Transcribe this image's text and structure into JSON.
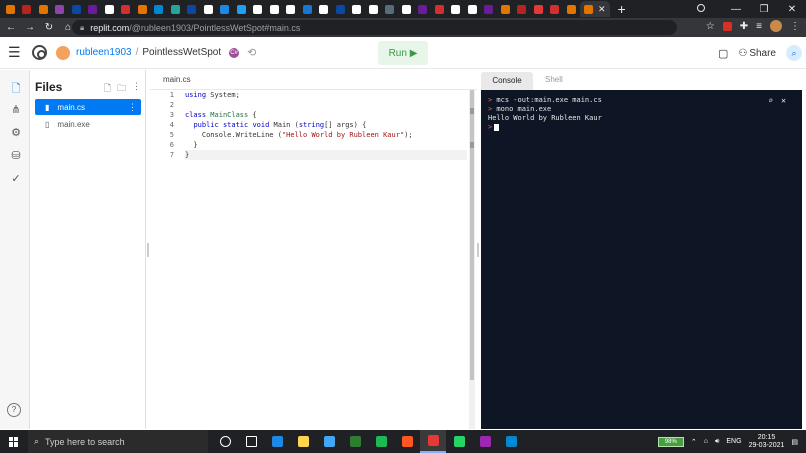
{
  "browser": {
    "tab_colors": [
      "#e37400",
      "#b3261e",
      "#e37400",
      "#8e44ad",
      "#0d47a1",
      "#6a1b9a",
      "#ffffff",
      "#d32f2f",
      "#e37400",
      "#0288d1",
      "#26a69a",
      "#0d47a1",
      "#ffffff",
      "#1e88e5",
      "#1da1f2",
      "#ffffff",
      "#ffffff",
      "#ffffff",
      "#1976d2",
      "#ffffff",
      "#0d47a1",
      "#ffffff",
      "#ffffff",
      "#546e7a",
      "#ffffff",
      "#6a1b9a",
      "#d32f2f",
      "#ffffff",
      "#ffffff",
      "#6a1b9a",
      "#e37400",
      "#b3261e",
      "#e53935",
      "#d32f2f",
      "#e37400",
      "#e37400"
    ],
    "active_tab_close": "✕",
    "new_tab": "+",
    "url_host": "replit.com",
    "url_path": "/@rubleen1903/PointlessWetSpot#main.cs"
  },
  "header": {
    "username": "rubleen1903",
    "separator": "/",
    "repl_name": "PointlessWetSpot",
    "language_badge": "C#",
    "run_label": "Run ▶",
    "share_label": "Share"
  },
  "files_panel": {
    "title": "Files",
    "files": [
      {
        "name": "main.cs",
        "selected": true
      },
      {
        "name": "main.exe",
        "selected": false
      }
    ]
  },
  "editor": {
    "tab_label": "main.cs",
    "line_numbers": [
      "1",
      "2",
      "3",
      "4",
      "5",
      "6",
      "7"
    ]
  },
  "console": {
    "tabs": [
      "Console",
      "Shell"
    ],
    "lines": [
      {
        "prompt": ">",
        "text": " mcs -out:main.exe main.cs"
      },
      {
        "prompt": ">",
        "text": " mono main.exe"
      },
      {
        "prompt": "",
        "text": "Hello World by Rubleen Kaur"
      }
    ],
    "cursor_prompt": ">"
  },
  "taskbar": {
    "search_placeholder": "Type here to search",
    "icon_colors": [
      "#ffffff",
      "#ffffff",
      "#1e88e5",
      "#ffd54f",
      "#42a5f5",
      "#2e7d32",
      "#1db954",
      "#ff5722",
      "#e53935",
      "#25d366",
      "#9c27b0",
      "#0288d1"
    ],
    "battery": "98%",
    "language": "ENG",
    "time": "20:15",
    "date": "29-03-2021"
  }
}
